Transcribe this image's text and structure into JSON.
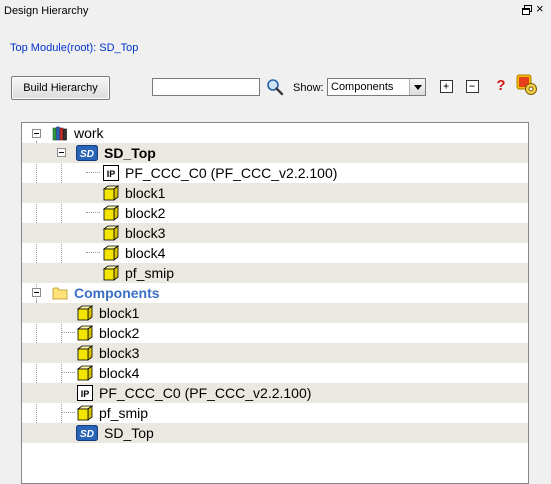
{
  "window": {
    "title": "Design Hierarchy"
  },
  "top_module": {
    "text": "Top Module(root): SD_Top"
  },
  "toolbar": {
    "build_label": "Build Hierarchy",
    "search_value": "",
    "show_label": "Show:",
    "show_selected": "Components",
    "icons": [
      "search-icon",
      "expand-all-icon",
      "collapse-all-icon",
      "help-icon",
      "settings-icon"
    ]
  },
  "tree": {
    "work": "work",
    "sd_top": "SD_Top",
    "sd_top_children": [
      {
        "label": "PF_CCC_C0 (PF_CCC_v2.2.100)",
        "icon": "ip-icon"
      },
      {
        "label": "block1",
        "icon": "block-icon"
      },
      {
        "label": "block2",
        "icon": "block-icon"
      },
      {
        "label": "block3",
        "icon": "block-icon"
      },
      {
        "label": "block4",
        "icon": "block-icon"
      },
      {
        "label": "pf_smip",
        "icon": "block-icon"
      }
    ],
    "components": "Components",
    "components_children": [
      {
        "label": "block1",
        "icon": "block-icon"
      },
      {
        "label": "block2",
        "icon": "block-icon"
      },
      {
        "label": "block3",
        "icon": "block-icon"
      },
      {
        "label": "block4",
        "icon": "block-icon"
      },
      {
        "label": "PF_CCC_C0 (PF_CCC_v2.2.100)",
        "icon": "ip-icon"
      },
      {
        "label": "pf_smip",
        "icon": "block-icon"
      },
      {
        "label": "SD_Top",
        "icon": "sd-icon"
      }
    ]
  },
  "colors": {
    "link_blue": "#0033cc",
    "folder_label": "#3a6fc4",
    "row_alt": "#ebe8e1"
  }
}
